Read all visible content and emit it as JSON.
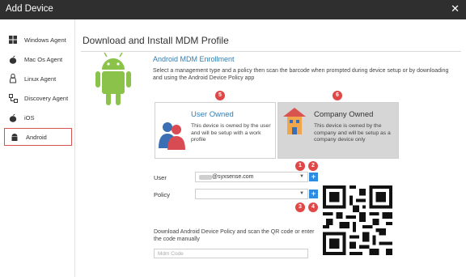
{
  "window": {
    "title": "Add Device"
  },
  "sidebar": {
    "items": [
      {
        "label": "Windows Agent",
        "icon": "windows-icon"
      },
      {
        "label": "Mac Os Agent",
        "icon": "apple-icon"
      },
      {
        "label": "Linux Agent",
        "icon": "linux-icon"
      },
      {
        "label": "Discovery Agent",
        "icon": "discovery-icon"
      },
      {
        "label": "iOS",
        "icon": "apple-icon"
      },
      {
        "label": "Android",
        "icon": "android-icon",
        "active": true
      }
    ]
  },
  "main": {
    "title": "Download and Install MDM Profile",
    "enrollment_title": "Android MDM Enrollment",
    "enrollment_desc": "Select a management type and a policy then scan the barcode when prompted during device setup or by downloading and using the Android Device Policy app",
    "cards": [
      {
        "badge": "5",
        "title": "User Owned",
        "desc": "This device is owned by the user and will be setup with a work profile",
        "icon": "user-icon",
        "selected": false
      },
      {
        "badge": "6",
        "title": "Company Owned",
        "desc": "This device is owned by the company and will be setup as a company device only",
        "icon": "company-icon",
        "selected": true
      }
    ],
    "form": {
      "user_label": "User",
      "user_value": "@syxsense.com",
      "policy_label": "Policy",
      "policy_value": "",
      "plus": "+",
      "badges": [
        "1",
        "2",
        "3",
        "4"
      ]
    },
    "download_text": "Download Android Device Policy and scan the QR code or enter the code manually",
    "mdm_code_placeholder": "Mdm Code"
  },
  "colors": {
    "accent": "#2e7fb6",
    "badge": "#e04848",
    "button": "#2e8de0",
    "android": "#8bc34a",
    "highlight": "#d9534f"
  }
}
